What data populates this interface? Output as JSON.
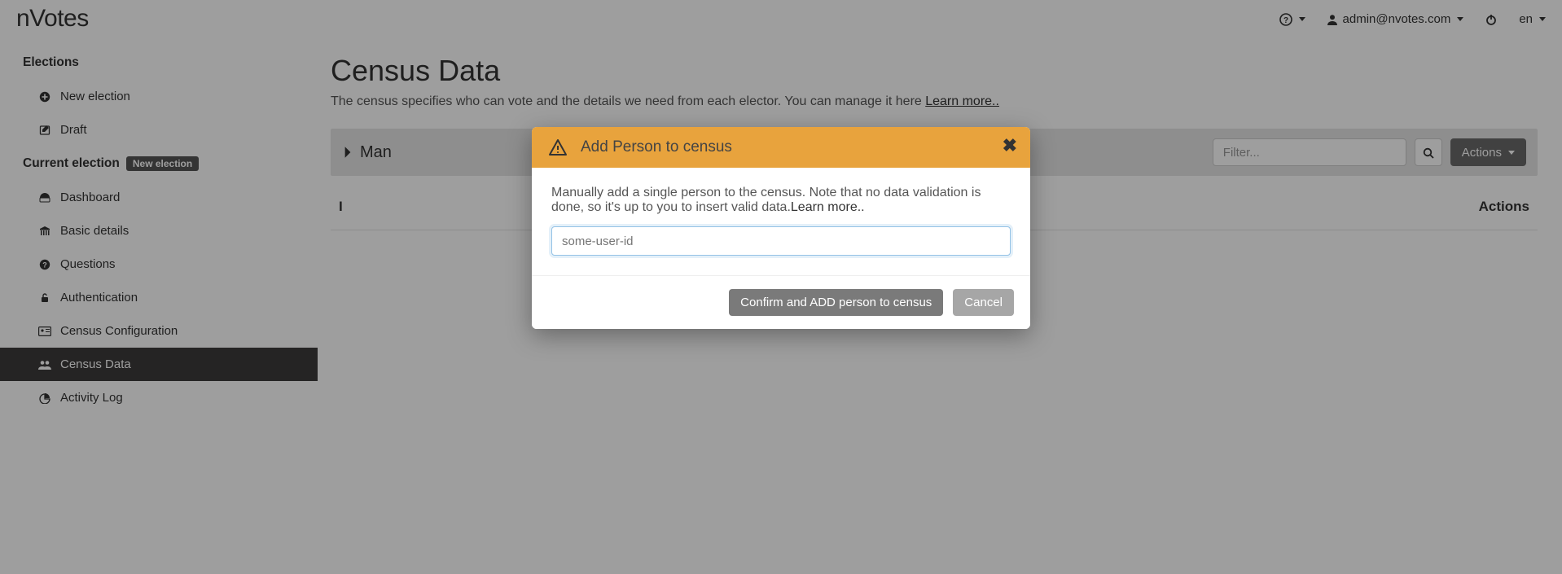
{
  "brand": "nVotes",
  "topbar": {
    "user": "admin@nvotes.com",
    "lang": "en"
  },
  "sidebar": {
    "heading_elections": "Elections",
    "new_election": "New election",
    "draft": "Draft",
    "heading_current": "Current election",
    "badge": "New election",
    "items": {
      "dashboard": "Dashboard",
      "basic": "Basic details",
      "questions": "Questions",
      "auth": "Authentication",
      "census_conf": "Census Configuration",
      "census_data": "Census Data",
      "activity": "Activity Log"
    }
  },
  "page": {
    "title": "Census Data",
    "subtitle": "The census specifies who can vote and the details we need from each elector. You can manage it here ",
    "learn": "Learn more.."
  },
  "toolbar": {
    "mange_prefix": "Man",
    "filter_placeholder": "Filter...",
    "actions": "Actions"
  },
  "table": {
    "col_id_visible": "I",
    "col_actions": "Actions"
  },
  "modal": {
    "title": "Add Person to census",
    "body": "Manually add a single person to the census. Note that no data validation is done, so it's up to you to insert valid data.",
    "learn": "Learn more..",
    "placeholder": "some-user-id",
    "confirm": "Confirm and ADD person to census",
    "cancel": "Cancel"
  }
}
